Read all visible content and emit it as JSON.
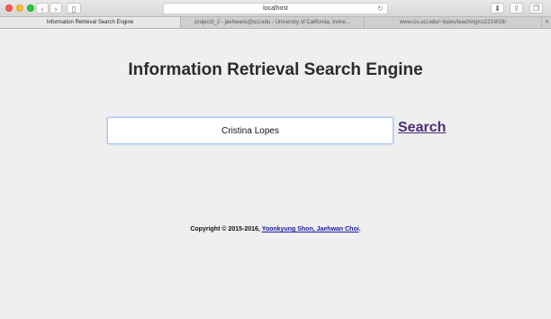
{
  "browser": {
    "url": "localhost",
    "tabs": [
      {
        "label": "Information Retrieval Search Engine"
      },
      {
        "label": "project3_2 - jaehwanc@uci.edu - University of California, Irvine..."
      },
      {
        "label": "www.ics.uci.edu/~lopes/teaching/cs221W16/"
      }
    ]
  },
  "page": {
    "title": "Information Retrieval Search Engine",
    "search": {
      "value": "Cristina Lopes",
      "button_label": "Search"
    },
    "footer": {
      "prefix": "Copyright © 2015-2016, ",
      "authors_link": "Yoonkyung Shon, Jaehwan Choi",
      "suffix": "."
    }
  }
}
